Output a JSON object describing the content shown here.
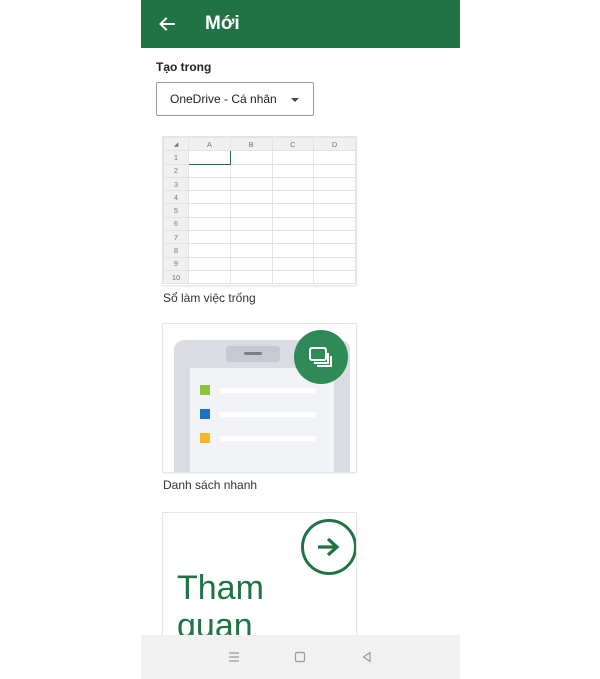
{
  "header": {
    "title": "Mới",
    "back_icon": "arrow-left-icon"
  },
  "location": {
    "label": "Tạo trong",
    "selected": "OneDrive - Cá nhân"
  },
  "templates": [
    {
      "caption": "Sổ làm việc trống",
      "grid": {
        "columns": [
          "A",
          "B",
          "C",
          "D"
        ],
        "rows": [
          "1",
          "2",
          "3",
          "4",
          "5",
          "6",
          "7",
          "8",
          "9",
          "10"
        ]
      }
    },
    {
      "caption": "Danh sách nhanh",
      "badge_icon": "stacked-pages-icon"
    },
    {
      "text_line1": "Tham",
      "text_line2": "quan",
      "arrow_icon": "arrow-right-circle-icon"
    }
  ],
  "colors": {
    "brand": "#217346",
    "badge": "#2e8b57",
    "item1": "#8cc43f",
    "item2": "#1b72c2",
    "item3": "#f5b823"
  },
  "nav": [
    "recents-icon",
    "home-icon",
    "back-triangle-icon"
  ]
}
